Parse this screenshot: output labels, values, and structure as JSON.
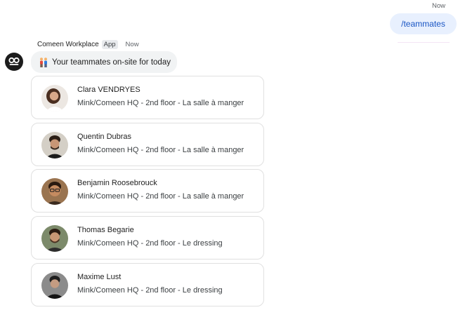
{
  "user_message": {
    "timestamp": "Now",
    "text": "/teammates"
  },
  "bot": {
    "name": "Comeen Workplace",
    "badge": "App",
    "timestamp": "Now",
    "intro": "Your teammates on-site for today",
    "intro_icon": "two-people-emoji"
  },
  "teammates": [
    {
      "name": "Clara VENDRYES",
      "location": "Mink/Comeen HQ - 2nd floor - La salle à manger"
    },
    {
      "name": "Quentin Dubras",
      "location": "Mink/Comeen HQ - 2nd floor - La salle à manger"
    },
    {
      "name": "Benjamin Roosebrouck",
      "location": "Mink/Comeen HQ - 2nd floor - La salle à manger"
    },
    {
      "name": "Thomas Begarie",
      "location": "Mink/Comeen HQ - 2nd floor - Le dressing"
    },
    {
      "name": "Maxime Lust",
      "location": "Mink/Comeen HQ - 2nd floor - Le dressing"
    }
  ],
  "colors": {
    "user_bubble_bg": "#e8f0fe",
    "user_bubble_text": "#1a56c4",
    "intro_bubble_bg": "#f1f3f4",
    "card_border": "#e0e0e0"
  }
}
